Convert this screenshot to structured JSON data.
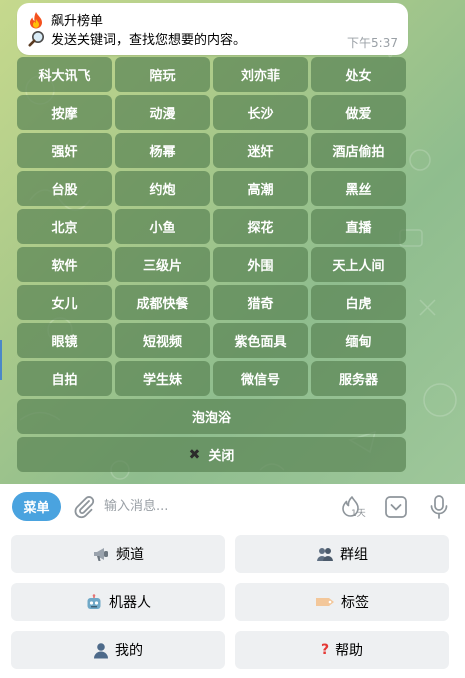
{
  "message": {
    "title_emoji": "fire-icon",
    "title": "飙升榜单",
    "body_emoji": "magnifier-icon",
    "body": "发送关键词，查找您想要的内容。",
    "time": "下午5:37"
  },
  "keyboard": {
    "buttons": [
      "科大讯飞",
      "陪玩",
      "刘亦菲",
      "处女",
      "按摩",
      "动漫",
      "长沙",
      "做爱",
      "强奸",
      "杨幂",
      "迷奸",
      "酒店偷拍",
      "台股",
      "约炮",
      "高潮",
      "黑丝",
      "北京",
      "小鱼",
      "探花",
      "直播",
      "软件",
      "三级片",
      "外围",
      "天上人间",
      "女儿",
      "成都快餐",
      "猎奇",
      "白虎",
      "眼镜",
      "短视频",
      "紫色面具",
      "缅甸",
      "自拍",
      "学生妹",
      "微信号",
      "服务器"
    ],
    "wide_button": "泡泡浴",
    "close_button": "关闭",
    "close_icon": "close-icon"
  },
  "input_bar": {
    "menu_label": "菜单",
    "placeholder": "输入消息...",
    "timer_label": "1天"
  },
  "reply_keyboard": {
    "channels": {
      "icon": "megaphone-icon",
      "label": "频道"
    },
    "groups": {
      "icon": "people-icon",
      "label": "群组"
    },
    "bots": {
      "icon": "robot-icon",
      "label": "机器人"
    },
    "tags": {
      "icon": "tag-icon",
      "label": "标签"
    },
    "mine": {
      "icon": "person-icon",
      "label": "我的"
    },
    "help": {
      "icon": "question-icon",
      "label": "帮助"
    }
  },
  "colors": {
    "keyboard_button": "#5c8556",
    "menu_button": "#4aa3df",
    "reply_button": "#eef0f2"
  }
}
